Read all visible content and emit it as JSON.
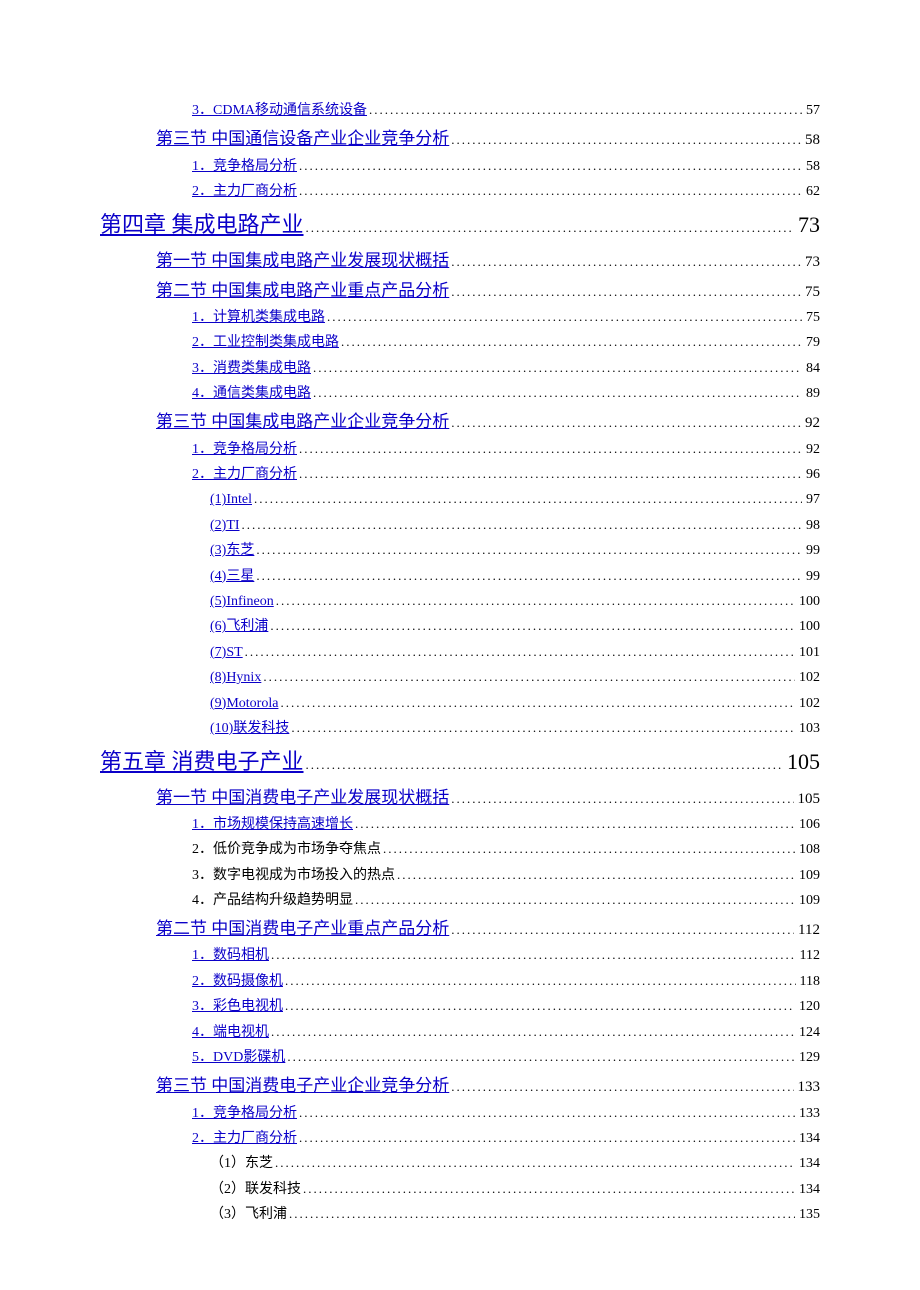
{
  "entries": [
    {
      "level": 3,
      "label": "3．CDMA移动通信系统设备",
      "page": "57",
      "link": true
    },
    {
      "level": 2,
      "label": "第三节 中国通信设备产业企业竞争分析",
      "page": "58",
      "link": true
    },
    {
      "level": 3,
      "label": "1．竞争格局分析",
      "page": "58",
      "link": true
    },
    {
      "level": 3,
      "label": "2．主力厂商分析",
      "page": "62",
      "link": true
    },
    {
      "level": 1,
      "label": "第四章 集成电路产业",
      "page": "73",
      "link": true
    },
    {
      "level": 2,
      "label": "第一节 中国集成电路产业发展现状概括",
      "page": "73",
      "link": true
    },
    {
      "level": 2,
      "label": "第二节 中国集成电路产业重点产品分析",
      "page": "75",
      "link": true
    },
    {
      "level": 3,
      "label": "1．计算机类集成电路",
      "page": "75",
      "link": true
    },
    {
      "level": 3,
      "label": "2．工业控制类集成电路",
      "page": "79",
      "link": true
    },
    {
      "level": 3,
      "label": "3．消费类集成电路",
      "page": "84",
      "link": true
    },
    {
      "level": 3,
      "label": "4．通信类集成电路",
      "page": "89",
      "link": true
    },
    {
      "level": 2,
      "label": "第三节 中国集成电路产业企业竞争分析",
      "page": "92",
      "link": true
    },
    {
      "level": 3,
      "label": "1．竞争格局分析",
      "page": "92",
      "link": true
    },
    {
      "level": 3,
      "label": "2．主力厂商分析",
      "page": "96",
      "link": true
    },
    {
      "level": 4,
      "label": "(1)Intel",
      "page": "97",
      "link": true
    },
    {
      "level": 4,
      "label": "(2)TI",
      "page": "98",
      "link": true
    },
    {
      "level": 4,
      "label": "(3)东芝",
      "page": "99",
      "link": true
    },
    {
      "level": 4,
      "label": "(4)三星",
      "page": "99",
      "link": true
    },
    {
      "level": 4,
      "label": "(5)Infineon",
      "page": "100",
      "link": true
    },
    {
      "level": 4,
      "label": "(6)飞利浦",
      "page": "100",
      "link": true
    },
    {
      "level": 4,
      "label": "(7)ST",
      "page": "101",
      "link": true
    },
    {
      "level": 4,
      "label": "(8)Hynix",
      "page": "102",
      "link": true
    },
    {
      "level": 4,
      "label": "(9)Motorola",
      "page": "102",
      "link": true
    },
    {
      "level": 4,
      "label": "(10)联发科技",
      "page": "103",
      "link": true
    },
    {
      "level": 1,
      "label": "第五章 消费电子产业",
      "page": "105",
      "link": true
    },
    {
      "level": 2,
      "label": "第一节 中国消费电子产业发展现状概括",
      "page": "105",
      "link": true
    },
    {
      "level": 3,
      "label": "1．市场规模保持高速增长",
      "page": "106",
      "link": true
    },
    {
      "level": 3,
      "label": "2．低价竞争成为市场争夺焦点",
      "page": "108",
      "link": false
    },
    {
      "level": 3,
      "label": "3．数字电视成为市场投入的热点",
      "page": "109",
      "link": false
    },
    {
      "level": 3,
      "label": "4．产品结构升级趋势明显",
      "page": "109",
      "link": false
    },
    {
      "level": 2,
      "label": "第二节 中国消费电子产业重点产品分析",
      "page": "112",
      "link": true
    },
    {
      "level": 3,
      "label": "1．数码相机",
      "page": "112",
      "link": true
    },
    {
      "level": 3,
      "label": "2．数码摄像机",
      "page": "118",
      "link": true
    },
    {
      "level": 3,
      "label": "3．彩色电视机",
      "page": "120",
      "link": true
    },
    {
      "level": 3,
      "label": "4．端电视机",
      "page": "124",
      "link": true
    },
    {
      "level": 3,
      "label": "5．DVD影碟机",
      "page": "129",
      "link": true
    },
    {
      "level": 2,
      "label": "第三节 中国消费电子产业企业竞争分析",
      "page": "133",
      "link": true
    },
    {
      "level": 3,
      "label": "1．竞争格局分析",
      "page": "133",
      "link": true
    },
    {
      "level": 3,
      "label": "2．主力厂商分析",
      "page": "134",
      "link": true
    },
    {
      "level": 4,
      "label": "（1）东芝",
      "page": "134",
      "link": false
    },
    {
      "level": 4,
      "label": "（2）联发科技",
      "page": "134",
      "link": false
    },
    {
      "level": 4,
      "label": "（3）飞利浦",
      "page": "135",
      "link": false
    }
  ]
}
